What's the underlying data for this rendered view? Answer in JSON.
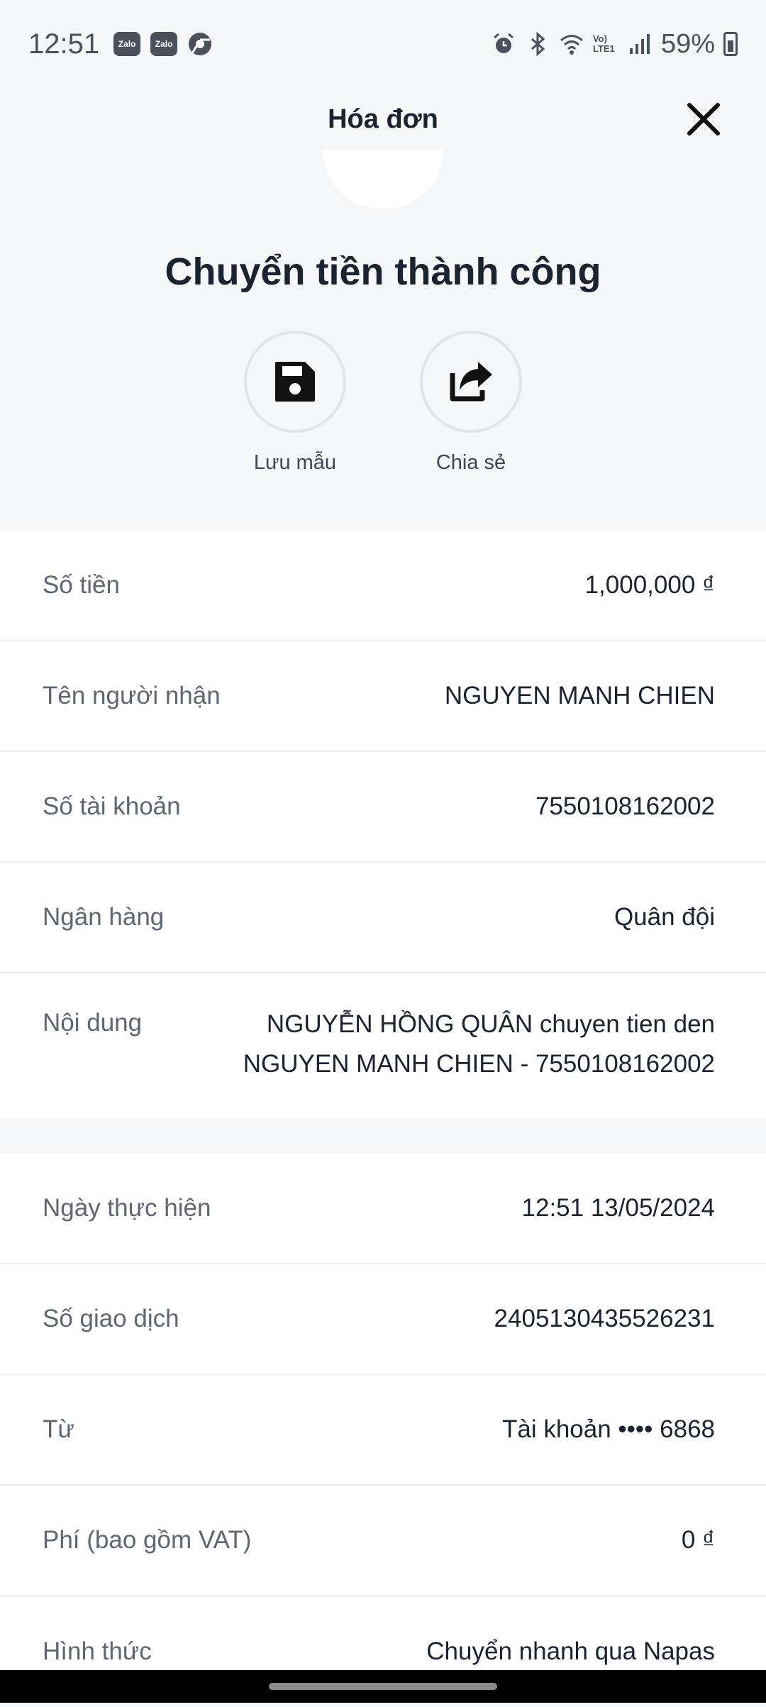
{
  "status": {
    "time": "12:51",
    "apps": [
      "Zalo",
      "Zalo"
    ],
    "battery": "59%",
    "network": "Vo) LTE1"
  },
  "header": {
    "title": "Hóa đơn",
    "close_icon": "close-icon"
  },
  "result": {
    "title": "Chuyển tiền thành công",
    "actions": [
      {
        "label": "Lưu mẫu",
        "icon": "save-icon"
      },
      {
        "label": "Chia sẻ",
        "icon": "share-icon"
      }
    ]
  },
  "details": [
    {
      "label": "Số tiền",
      "value": "1,000,000 ₫"
    },
    {
      "label": "Tên người nhận",
      "value": "NGUYEN MANH CHIEN"
    },
    {
      "label": "Số tài khoản",
      "value": "7550108162002"
    },
    {
      "label": "Ngân hàng",
      "value": "Quân đội"
    },
    {
      "label": "Nội dung",
      "value": "NGUYỄN HỒNG QUÂN chuyen tien den NGUYEN MANH CHIEN - 7550108162002"
    }
  ],
  "transaction": [
    {
      "label": "Ngày thực hiện",
      "value": "12:51 13/05/2024"
    },
    {
      "label": "Số giao dịch",
      "value": "2405130435526231"
    },
    {
      "label": "Từ",
      "value": "Tài khoản •••• 6868"
    },
    {
      "label": "Phí (bao gồm VAT)",
      "value": "0 ₫"
    },
    {
      "label": "Hình thức",
      "value": "Chuyển nhanh qua Napas"
    }
  ]
}
